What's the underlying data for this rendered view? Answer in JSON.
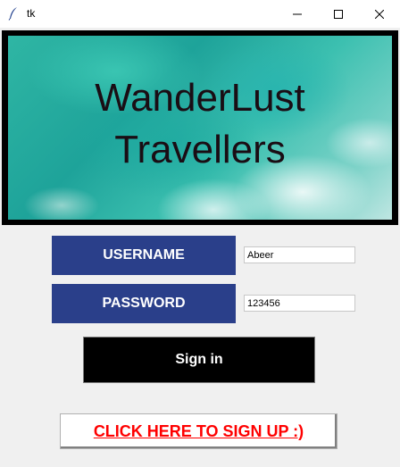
{
  "window": {
    "title": "tk"
  },
  "banner": {
    "line1": "WanderLust",
    "line2": "Travellers"
  },
  "form": {
    "username_label": "USERNAME",
    "username_value": "Abeer",
    "password_label": "PASSWORD",
    "password_value": "123456"
  },
  "buttons": {
    "signin_label": "Sign in",
    "signup_label": "CLICK HERE TO SIGN UP :)"
  },
  "colors": {
    "label_bg": "#2a3f8a",
    "signin_bg": "#000000",
    "signup_text": "#ff0000"
  }
}
